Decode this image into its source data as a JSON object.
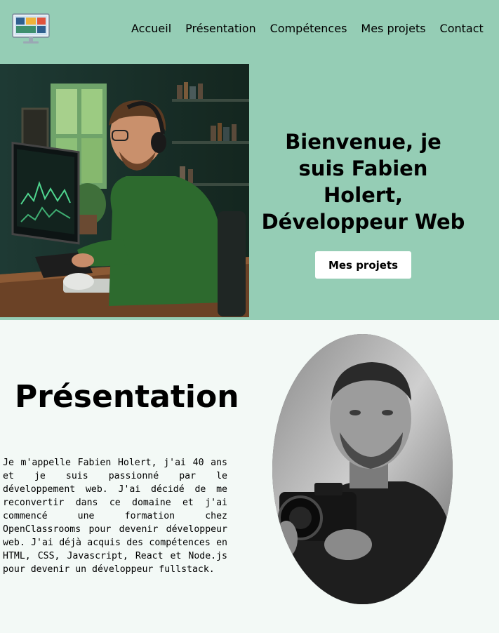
{
  "nav": {
    "items": [
      "Accueil",
      "Présentation",
      "Compétences",
      "Mes projets",
      "Contact"
    ]
  },
  "hero": {
    "title": "Bienvenue, je suis Fabien Holert, Développeur Web",
    "button": "Mes projets"
  },
  "presentation": {
    "title": "Présentation",
    "text": "Je m'appelle Fabien Holert, j'ai 40 ans et je suis passionné par le développement web. J'ai décidé de me reconvertir dans ce domaine et j'ai commencé une formation chez OpenClassrooms pour devenir développeur web. J'ai déjà acquis des compétences en HTML, CSS, Javascript, React et Node.js pour devenir un développeur fullstack."
  },
  "colors": {
    "header_bg": "#95cdb5",
    "page_bg": "#f3f9f6",
    "button_bg": "#ffffff"
  },
  "icons": {
    "logo": "computer-monitor-logo-icon"
  }
}
